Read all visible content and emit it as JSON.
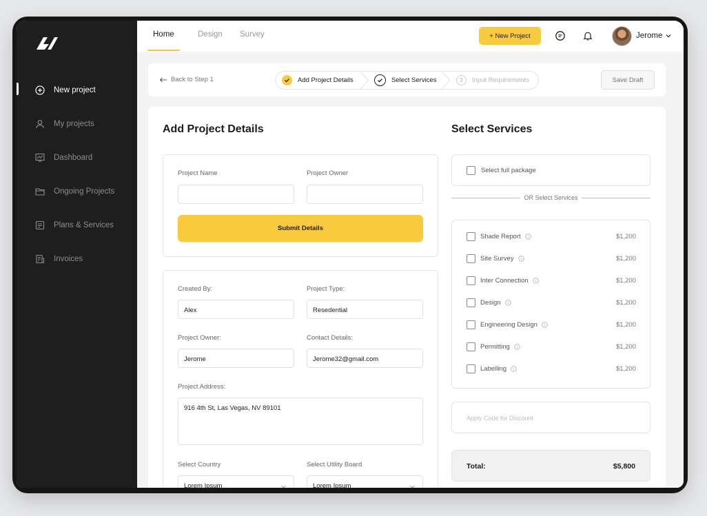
{
  "sidebar": {
    "items": [
      {
        "label": "New project",
        "icon": "plus-circle-icon",
        "active": true
      },
      {
        "label": "My projects",
        "icon": "user-icon",
        "active": false
      },
      {
        "label": "Dashboard",
        "icon": "presentation-icon",
        "active": false
      },
      {
        "label": "Ongoing Projects",
        "icon": "folder-icon",
        "active": false
      },
      {
        "label": "Plans & Services",
        "icon": "document-icon",
        "active": false
      },
      {
        "label": "Invoices",
        "icon": "invoice-icon",
        "active": false
      }
    ]
  },
  "topbar": {
    "tabs": [
      {
        "label": "Home",
        "active": true
      },
      {
        "label": "Design",
        "active": false
      },
      {
        "label": "Survey",
        "active": false
      }
    ],
    "new_project_label": "+ New Project",
    "user_name": "Jerome"
  },
  "stepper": {
    "back_label": "Back to Step 1",
    "steps": [
      {
        "label": "Add Project Details",
        "state": "done"
      },
      {
        "label": "Select Services",
        "state": "current"
      },
      {
        "label": "Input Requirements",
        "number": "3",
        "state": "pending"
      }
    ],
    "save_draft_label": "Save Draft"
  },
  "details": {
    "title": "Add Project Details",
    "project_name_label": "Project Name",
    "project_owner_label": "Project Owner",
    "submit_label": "Submit Details",
    "created_by_label": "Created By:",
    "created_by_value": "Alex",
    "project_type_label": "Project Type:",
    "project_type_value": "Resedential",
    "owner_label": "Project Owner:",
    "owner_value": "Jerome",
    "contact_label": "Contact Details:",
    "contact_value": "Jerome32@gmail.com",
    "address_label": "Project Address:",
    "address_value": "916 4th St, Las Vegas, NV 89101",
    "country_label": "Select Country",
    "country_value": "Lorem Ipsum",
    "utility_label": "Select Utility Board",
    "utility_value": "Lorem Ipsum"
  },
  "services": {
    "title": "Select Services",
    "full_package_label": "Select full package",
    "or_label": "OR Select Services",
    "items": [
      {
        "label": "Shade Report",
        "price": "$1,200"
      },
      {
        "label": "Site Survey",
        "price": "$1,200"
      },
      {
        "label": "Inter Connection",
        "price": "$1,200"
      },
      {
        "label": "Design",
        "price": "$1,200"
      },
      {
        "label": "Engineering Design",
        "price": "$1,200"
      },
      {
        "label": "Permitting",
        "price": "$1,200"
      },
      {
        "label": "Labelling",
        "price": "$1,200"
      }
    ],
    "discount_placeholder": "Apply Code for Discount",
    "total_label": "Total:",
    "total_value": "$5,800"
  },
  "colors": {
    "accent": "#F9C93E",
    "sidebar_bg": "#1E1E1E",
    "page_bg": "#F4F4F5"
  }
}
